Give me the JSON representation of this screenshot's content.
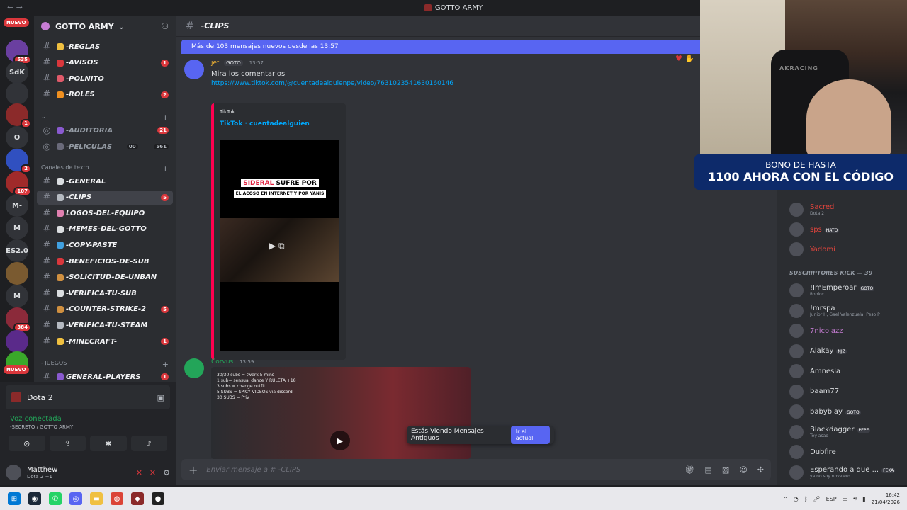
{
  "window": {
    "title": "GOTTO ARMY"
  },
  "server_rail": [
    {
      "label": "NUEVO",
      "kind": "pill"
    },
    {
      "label": "",
      "badge": "535"
    },
    {
      "label": "SdK"
    },
    {
      "label": ""
    },
    {
      "label": "",
      "badge": "1"
    },
    {
      "label": "O"
    },
    {
      "label": "",
      "badge": "2"
    },
    {
      "label": "",
      "badge": "107"
    },
    {
      "label": "M-"
    },
    {
      "label": "M"
    },
    {
      "label": "ES2.0"
    },
    {
      "label": ""
    },
    {
      "label": "M"
    },
    {
      "label": "",
      "badge": "384"
    },
    {
      "label": ""
    },
    {
      "label": ""
    },
    {
      "label": "NUEVO",
      "kind": "pill"
    }
  ],
  "guild": {
    "name": "GOTTO ARMY"
  },
  "channels": [
    {
      "name": "-REGLAS",
      "badge": ""
    },
    {
      "name": "-AVISOS",
      "badge": "1"
    },
    {
      "name": "-POLNITO",
      "badge": ""
    },
    {
      "name": "-ROLES",
      "badge": "2"
    }
  ],
  "voice_channels": [
    {
      "name": "-AUDITORIA",
      "badge": "21"
    },
    {
      "name": "-PELICULAS",
      "count_a": "00",
      "count_b": "561"
    }
  ],
  "text_category": "Canales de texto",
  "text_channels": [
    {
      "name": "-GENERAL",
      "badge": ""
    },
    {
      "name": "-CLIPS",
      "badge": "5"
    },
    {
      "name": "LOGOS-DEL-EQUIPO",
      "badge": ""
    },
    {
      "name": "-MEMES-DEL-GOTTO",
      "badge": ""
    },
    {
      "name": "-COPY-PASTE",
      "badge": ""
    },
    {
      "name": "-BENEFICIOS-DE-SUB",
      "badge": ""
    },
    {
      "name": "-SOLICITUD-DE-UNBAN",
      "badge": ""
    },
    {
      "name": "-VERIFICA-TU-SUB",
      "badge": ""
    },
    {
      "name": "-COUNTER-STRIKE-2",
      "badge": "5"
    },
    {
      "name": "-VERIFICA-TU-STEAM",
      "badge": ""
    },
    {
      "name": "-MINECRAFT-",
      "badge": "1"
    }
  ],
  "games_category": "- JUEGOS",
  "games_channels": [
    {
      "name": "GENERAL-PLAYERS",
      "badge": "1"
    }
  ],
  "voice_panel": {
    "activity": "Dota 2",
    "status": "Voz conectada",
    "channel": "-SECRETO / GOTTO ARMY"
  },
  "user": {
    "name": "Matthew",
    "status": "Dota 2 +1"
  },
  "chat": {
    "channel_name": "-CLIPS",
    "new_messages_bar": "Más de 103 mensajes nuevos desde las 13:57",
    "messages": [
      {
        "author": "jef",
        "tag": "GOTO",
        "time": "13:57",
        "text": "Mira los comentarios",
        "link": "https://www.tiktok.com/@cuentadealguienpe/video/7631023541630160146",
        "embed": {
          "provider": "TikTok",
          "title": "TikTok · cuentadealguien",
          "caption_red": "SIDERAL",
          "caption_black": " SUFRE POR",
          "caption_sub": "EL ACOSO EN INTERNET Y POR YANIS"
        }
      },
      {
        "author": "Corvus",
        "time": "13:59",
        "video_text": "30/30 subs = twerk 5 mins\n1 sub= sensual dance Y RULETA +18\n3 subs = change outfit\n5 SUBS = SPICY VIDEOS via discord\n30 SUBS = Priv"
      }
    ],
    "old_messages_notice": "Estás Viendo Mensajes Antiguos",
    "jump_button": "Ir al actual",
    "composer_placeholder": "Enviar mensaje a # -CLIPS"
  },
  "promo": {
    "line1": "BONO DE HASTA",
    "line2": "1100 AHORA CON EL CÓDIGO"
  },
  "cam_logo": "AKRACING",
  "members": {
    "top": [
      {
        "name": "Sacred",
        "sub": "Dota 2",
        "color": "#e0443c"
      },
      {
        "name": "sps",
        "tag": "HATO",
        "color": "#e0443c"
      },
      {
        "name": "Yadomi",
        "color": "#e0443c"
      }
    ],
    "category": "SUSCRIPTORES KICK — 39",
    "subs": [
      {
        "name": "!ImEmperoar",
        "tag": "GOTO",
        "sub": "Roblox",
        "color": "#dbdee1"
      },
      {
        "name": "!mrspa",
        "sub": "Junior H, Gael Valenzuela, Peso P",
        "color": "#dbdee1"
      },
      {
        "name": "7nicolazz",
        "sub": "",
        "color": "#c77dd4"
      },
      {
        "name": "Alakay",
        "tag": "NJZ",
        "color": "#dbdee1"
      },
      {
        "name": "Amnesia",
        "color": "#dbdee1"
      },
      {
        "name": "baam77",
        "color": "#dbdee1"
      },
      {
        "name": "babyblay",
        "tag": "GOTO",
        "color": "#dbdee1"
      },
      {
        "name": "Blackdagger",
        "tag": "PEPE",
        "sub": "Toy asao",
        "color": "#dbdee1"
      },
      {
        "name": "Dubfire",
        "color": "#dbdee1"
      },
      {
        "name": "Esperando a que ...",
        "tag": "FEKA",
        "sub": "ya no soy novelero",
        "color": "#dbdee1"
      }
    ]
  },
  "taskbar": {
    "lang": "ESP",
    "time": "16:42",
    "date": "21/04/2026"
  }
}
